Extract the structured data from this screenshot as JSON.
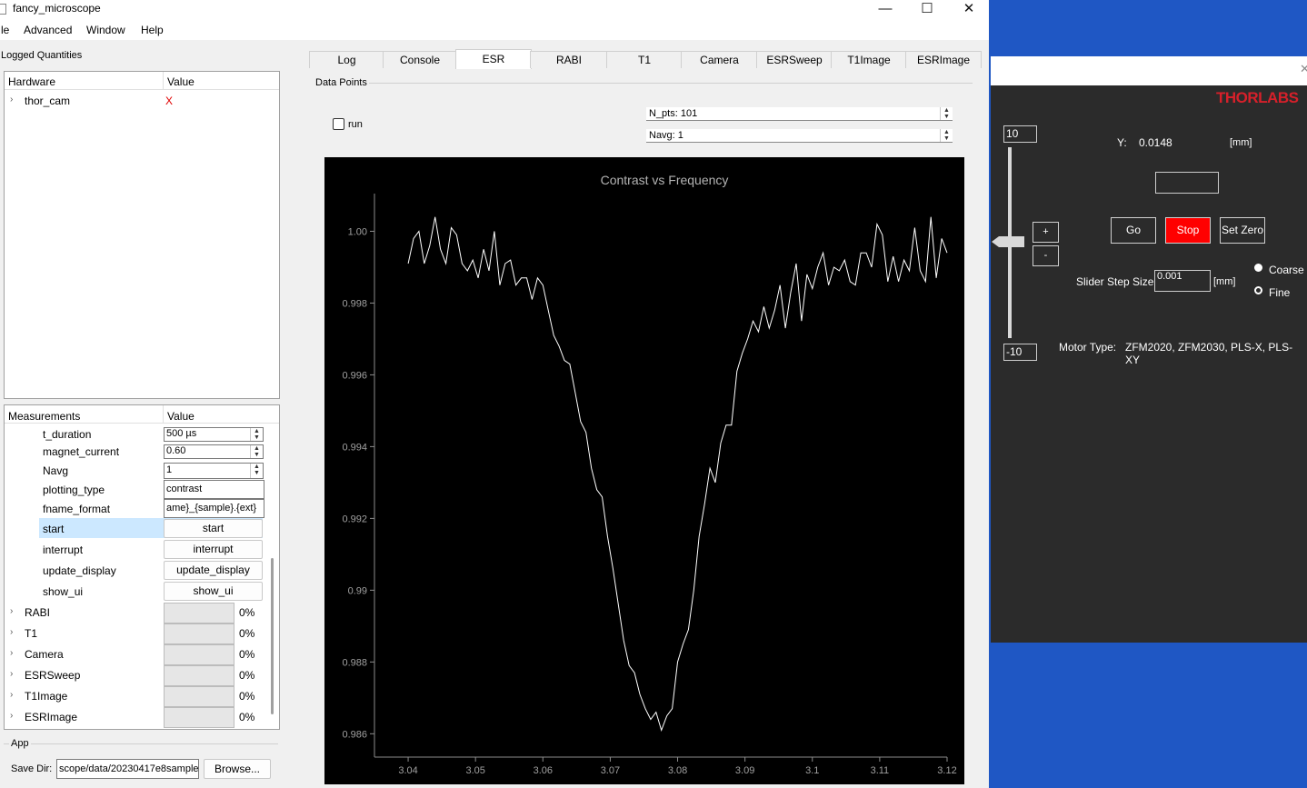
{
  "window": {
    "title": "fancy_microscope",
    "minimize": "—",
    "maximize": "☐",
    "close": "✕"
  },
  "menu": [
    "le",
    "Advanced",
    "Window",
    "Help"
  ],
  "logged": {
    "title": "Logged Quantities",
    "col_hardware": "Hardware",
    "col_value": "Value",
    "items": [
      {
        "name": "thor_cam",
        "value": "X"
      }
    ]
  },
  "measurements": {
    "col_name": "Measurements",
    "col_value": "Value",
    "t_duration": {
      "label": "t_duration",
      "value": "500 µs"
    },
    "magnet_current": {
      "label": "magnet_current",
      "value": "0.60"
    },
    "navg": {
      "label": "Navg",
      "value": "1"
    },
    "plotting_type": {
      "label": "plotting_type",
      "value": "contrast"
    },
    "fname_format": {
      "label": "fname_format",
      "value": "ame}_{sample}.{ext}"
    },
    "start": {
      "label": "start",
      "button": "start"
    },
    "interrupt": {
      "label": "interrupt",
      "button": "interrupt"
    },
    "update_display": {
      "label": "update_display",
      "button": "update_display"
    },
    "show_ui": {
      "label": "show_ui",
      "button": "show_ui"
    },
    "collapsed": [
      {
        "name": "RABI",
        "pct": "0%"
      },
      {
        "name": "T1",
        "pct": "0%"
      },
      {
        "name": "Camera",
        "pct": "0%"
      },
      {
        "name": "ESRSweep",
        "pct": "0%"
      },
      {
        "name": "T1Image",
        "pct": "0%"
      },
      {
        "name": "ESRImage",
        "pct": "0%"
      }
    ]
  },
  "app": {
    "title": "App",
    "save_dir_label": "Save Dir:",
    "save_dir_value": "scope/data/20230417e8sample",
    "browse": "Browse..."
  },
  "tabs": [
    "Log",
    "Console",
    "ESR",
    "RABI",
    "T1",
    "Camera",
    "ESRSweep",
    "T1Image",
    "ESRImage"
  ],
  "active_tab": "ESR",
  "datapoints": {
    "title": "Data Points",
    "run_label": "run",
    "npts": "N_pts: 101",
    "navg": "Navg: 1"
  },
  "chart_data": {
    "type": "line",
    "title": "Contrast vs Frequency",
    "xlabel": "",
    "ylabel": "",
    "xlim": [
      3.035,
      3.12
    ],
    "ylim": [
      0.98535,
      1.00105
    ],
    "x_ticks": [
      "3.04",
      "3.05",
      "3.06",
      "3.07",
      "3.08",
      "3.09",
      "3.1",
      "3.11",
      "3.12"
    ],
    "x_tick_values": [
      3.04,
      3.05,
      3.06,
      3.07,
      3.08,
      3.09,
      3.1,
      3.11,
      3.12
    ],
    "y_ticks": [
      "1.00",
      "0.998",
      "0.996",
      "0.994",
      "0.992",
      "0.99",
      "0.988",
      "0.986"
    ],
    "y_tick_values": [
      1.0,
      0.998,
      0.996,
      0.994,
      0.992,
      0.99,
      0.988,
      0.986
    ],
    "grid": false,
    "line_color": "#ffffff",
    "x": [
      3.04,
      3.0408,
      3.0416,
      3.0424,
      3.0432,
      3.044,
      3.0448,
      3.0456,
      3.0464,
      3.0472,
      3.048,
      3.0488,
      3.0496,
      3.0504,
      3.0512,
      3.052,
      3.0528,
      3.0536,
      3.0544,
      3.0552,
      3.056,
      3.0568,
      3.0576,
      3.0584,
      3.0592,
      3.06,
      3.0608,
      3.0616,
      3.0624,
      3.0632,
      3.064,
      3.0648,
      3.0656,
      3.0664,
      3.0672,
      3.068,
      3.0688,
      3.0696,
      3.0704,
      3.0712,
      3.072,
      3.0728,
      3.0736,
      3.0744,
      3.0752,
      3.076,
      3.0768,
      3.0776,
      3.0784,
      3.0792,
      3.08,
      3.0808,
      3.0816,
      3.0824,
      3.0832,
      3.084,
      3.0848,
      3.0856,
      3.0864,
      3.0872,
      3.088,
      3.0888,
      3.0896,
      3.0904,
      3.0912,
      3.092,
      3.0928,
      3.0936,
      3.0944,
      3.0952,
      3.096,
      3.0968,
      3.0976,
      3.0984,
      3.0992,
      3.1,
      3.1008,
      3.1016,
      3.1024,
      3.1032,
      3.104,
      3.1048,
      3.1056,
      3.1064,
      3.1072,
      3.108,
      3.1088,
      3.1096,
      3.1104,
      3.1112,
      3.112,
      3.1128,
      3.1136,
      3.1144,
      3.1152,
      3.116,
      3.1168,
      3.1176,
      3.1184,
      3.1192,
      3.12
    ],
    "values": [
      0.9991,
      0.9998,
      1.0,
      0.9991,
      0.9996,
      1.0004,
      0.9995,
      0.9991,
      1.0001,
      0.9999,
      0.9991,
      0.9989,
      0.9992,
      0.9987,
      0.9995,
      0.9989,
      1.0,
      0.9985,
      0.9991,
      0.9992,
      0.9985,
      0.9987,
      0.9987,
      0.9981,
      0.9987,
      0.9985,
      0.9978,
      0.9971,
      0.9968,
      0.9964,
      0.9963,
      0.9955,
      0.9947,
      0.9944,
      0.9934,
      0.9928,
      0.9926,
      0.9915,
      0.9906,
      0.9896,
      0.9886,
      0.9879,
      0.9877,
      0.9871,
      0.9867,
      0.9864,
      0.9866,
      0.9861,
      0.9865,
      0.9867,
      0.988,
      0.9885,
      0.9889,
      0.99,
      0.9915,
      0.9924,
      0.9934,
      0.993,
      0.9941,
      0.9946,
      0.9946,
      0.9961,
      0.9966,
      0.997,
      0.9975,
      0.9972,
      0.9979,
      0.9973,
      0.9978,
      0.9985,
      0.9973,
      0.9983,
      0.9991,
      0.9975,
      0.9988,
      0.9984,
      0.999,
      0.9994,
      0.9985,
      0.999,
      0.9989,
      0.9992,
      0.9986,
      0.9985,
      0.9994,
      0.9994,
      0.999,
      1.0002,
      0.9999,
      0.9986,
      0.9993,
      0.9986,
      0.9992,
      0.9989,
      1.0001,
      0.9989,
      0.9986,
      1.0004,
      0.9987,
      0.9998,
      0.9994
    ]
  },
  "thorlabs": {
    "logo": "THORLABS",
    "slider_max": "10",
    "slider_min": "-10",
    "y_label": "Y:",
    "y_value": "0.0148",
    "y_unit": "[mm]",
    "go": "Go",
    "stop": "Stop",
    "set_zero": "Set Zero",
    "plus": "+",
    "minus": "-",
    "step_label": "Slider Step Size",
    "step_value": "0.001",
    "step_unit": "[mm]",
    "coarse": "Coarse",
    "fine": "Fine",
    "motor_label": "Motor Type:",
    "motor_value": "ZFM2020, ZFM2030, PLS-X, PLS-XY",
    "close": "✕",
    "stop_color": "#ff0000",
    "logo_color": "#d6202a"
  }
}
